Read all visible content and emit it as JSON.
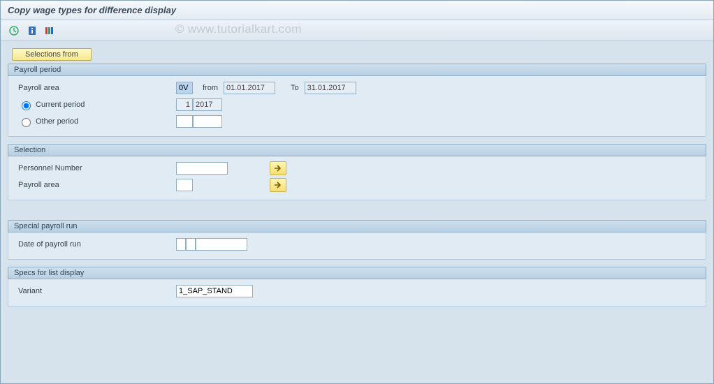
{
  "title": "Copy wage types for difference display",
  "watermark": "© www.tutorialkart.com",
  "toolbar": {
    "execute_icon": "execute-icon",
    "info_icon": "info-icon",
    "variant_icon": "variant-icon"
  },
  "selections_from_label": "Selections from",
  "groups": {
    "payroll_period": {
      "title": "Payroll period",
      "payroll_area_label": "Payroll area",
      "payroll_area_value": "0V",
      "from_label": "from",
      "from_value": "01.01.2017",
      "to_label": "To",
      "to_value": "31.01.2017",
      "current_period_label": "Current period",
      "current_period_num": "1",
      "current_period_year": "2017",
      "other_period_label": "Other period",
      "other_period_num": "",
      "other_period_year": "",
      "selected_radio": "current"
    },
    "selection": {
      "title": "Selection",
      "personnel_number_label": "Personnel Number",
      "personnel_number_value": "",
      "payroll_area_label": "Payroll area",
      "payroll_area_value": ""
    },
    "special_payroll_run": {
      "title": "Special payroll run",
      "date_label": "Date of payroll run",
      "code1": "",
      "code2": "",
      "date_value": ""
    },
    "specs_list_display": {
      "title": "Specs for list display",
      "variant_label": "Variant",
      "variant_value": "1_SAP_STAND"
    }
  }
}
